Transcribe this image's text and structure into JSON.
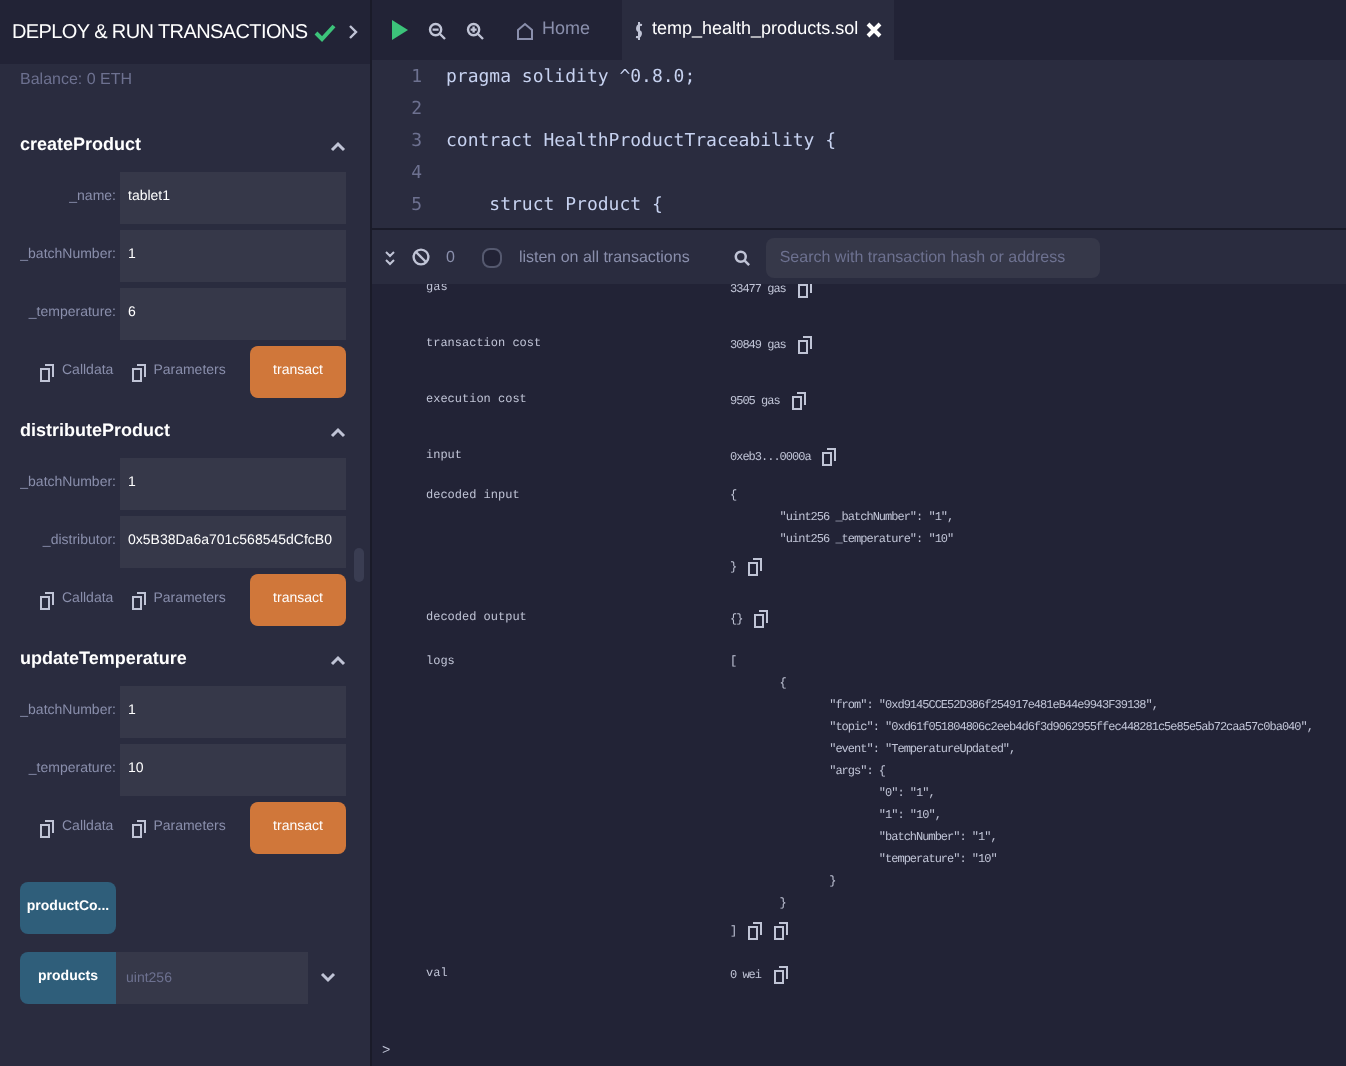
{
  "panel": {
    "title": "DEPLOY & RUN TRANSACTIONS",
    "balance": "Balance: 0 ETH",
    "functions": [
      {
        "name": "createProduct",
        "expanded": true,
        "params": [
          {
            "label": "_name:",
            "value": "tablet1"
          },
          {
            "label": "_batchNumber:",
            "value": "1"
          },
          {
            "label": "_temperature:",
            "value": "6"
          }
        ],
        "calldata": "Calldata",
        "parameters": "Parameters",
        "action": "transact"
      },
      {
        "name": "distributeProduct",
        "expanded": true,
        "params": [
          {
            "label": "_batchNumber:",
            "value": "1"
          },
          {
            "label": "_distributor:",
            "value": "0x5B38Da6a701c568545dCfcB0"
          }
        ],
        "calldata": "Calldata",
        "parameters": "Parameters",
        "action": "transact"
      },
      {
        "name": "updateTemperature",
        "expanded": true,
        "params": [
          {
            "label": "_batchNumber:",
            "value": "1"
          },
          {
            "label": "_temperature:",
            "value": "10"
          }
        ],
        "calldata": "Calldata",
        "parameters": "Parameters",
        "action": "transact"
      }
    ],
    "getters": [
      {
        "kind": "plain",
        "label": "productCo..."
      },
      {
        "kind": "input",
        "label": "products",
        "placeholder": "uint256"
      }
    ]
  },
  "tabs": [
    {
      "label": "Home",
      "selected": false
    },
    {
      "label": "temp_health_products.sol",
      "selected": true
    }
  ],
  "editor": {
    "lines": [
      {
        "number": "1",
        "code": "pragma solidity ^0.8.0;"
      },
      {
        "number": "2"
      },
      {
        "number": "3",
        "code": "contract HealthProductTraceability {"
      },
      {
        "number": "4"
      },
      {
        "number": "5",
        "code": "    struct Product {"
      }
    ]
  },
  "terminal": {
    "count": "0",
    "listen_label": "listen on all transactions",
    "listen_checked": false,
    "search_placeholder": "Search with transaction hash or address",
    "rows": [
      {
        "label": "gas",
        "value": [
          "33477 gas"
        ]
      },
      {
        "label": "transaction cost",
        "value": [
          "30849 gas"
        ]
      },
      {
        "label": "execution cost",
        "value": [
          "9505 gas"
        ]
      },
      {
        "label": "input",
        "value": [
          "0xeb3...0000a"
        ]
      },
      {
        "label": "decoded input",
        "value": [
          "{",
          "        \"uint256 _batchNumber\": \"1\",",
          "        \"uint256 _temperature\": \"10\"",
          "}"
        ]
      },
      {
        "label": "decoded output",
        "value": [
          "{}"
        ]
      },
      {
        "label": "logs",
        "value": [
          "[",
          "        {",
          "                \"from\": \"0xd9145CCE52D386f254917e481eB44e9943F39138\",",
          "                \"topic\": \"0xd61f051804806c2eeb4d6f3d9062955ffec448281c5e85e5ab72caa57c0ba040\",",
          "                \"event\": \"TemperatureUpdated\",",
          "                \"args\": {",
          "                        \"0\": \"1\",",
          "                        \"1\": \"10\",",
          "                        \"batchNumber\": \"1\",",
          "                        \"temperature\": \"10\"",
          "                }",
          "        }",
          "]"
        ]
      },
      {
        "label": "val",
        "value": [
          "0 wei"
        ]
      }
    ],
    "prompt": ">"
  }
}
